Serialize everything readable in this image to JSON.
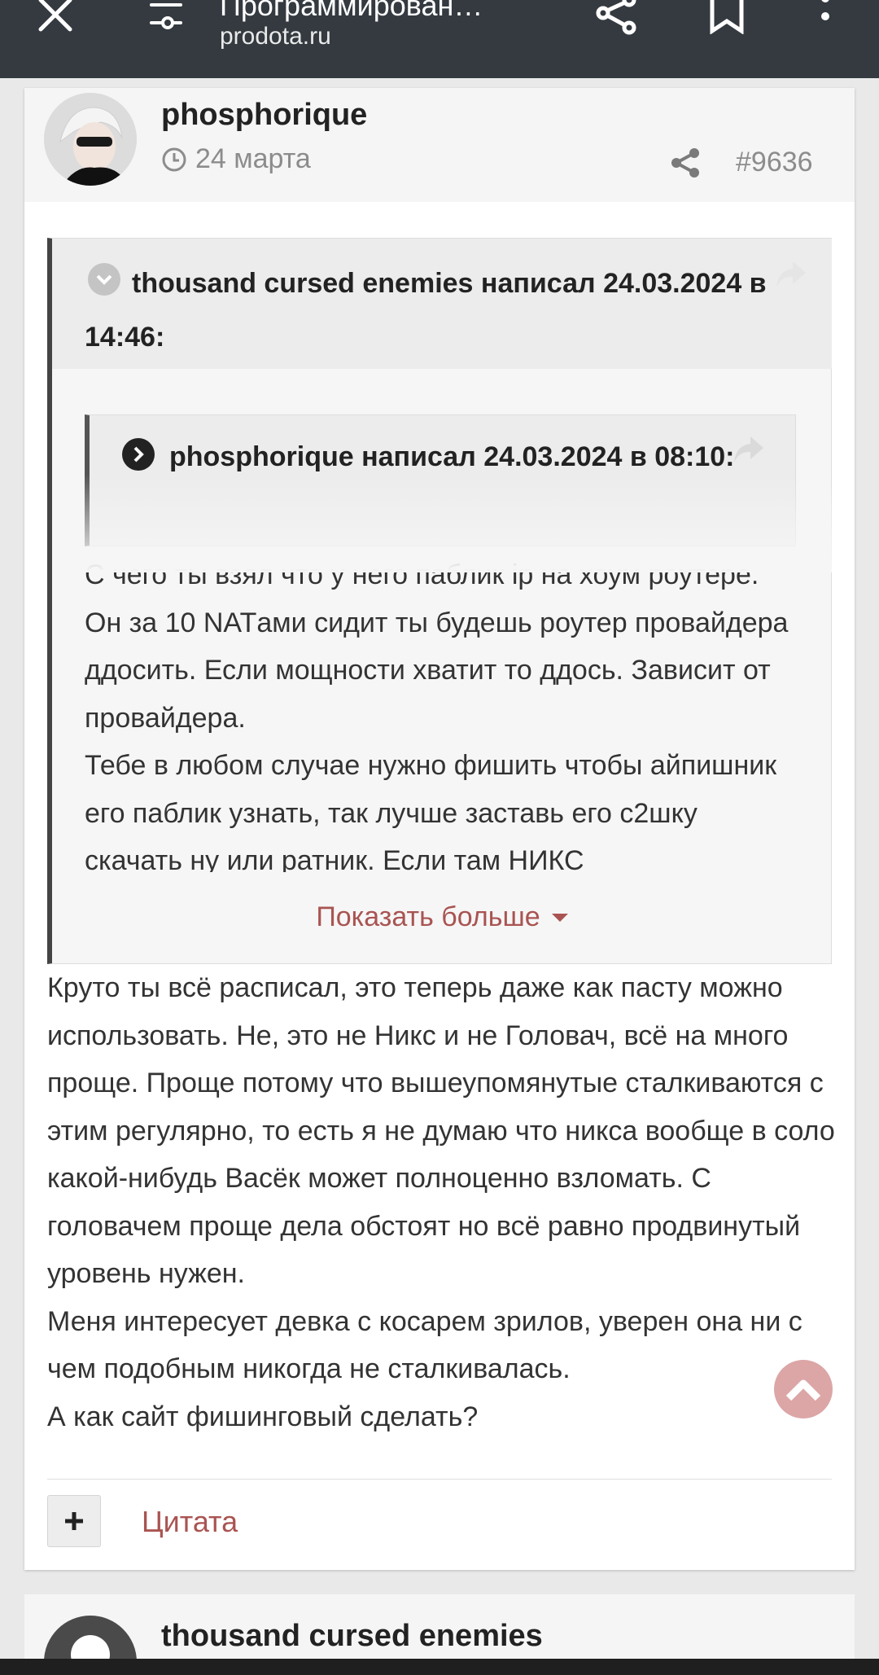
{
  "browser": {
    "title": "Программирован…",
    "domain": "prodota.ru",
    "icons": [
      "close-icon",
      "tune-icon",
      "share-icon",
      "bookmark-icon",
      "more-vert-icon"
    ]
  },
  "post": {
    "author": "phosphorique",
    "date": "24 марта",
    "number": "#9636",
    "outer_quote": {
      "header": "thousand cursed enemies написал 24.03.2024 в 14:46:"
    },
    "inner_quote": {
      "header": "phosphorique написал 24.03.2024 в 08:10:"
    },
    "quoted_lines": [
      "С чего ты взял что у него паблик ip на хоум роутере. Он за 10 NATами сидит ты будешь роутер провайдера ддосить. Если мощности хватит то ддось. Зависит от провайдера.",
      "Тебе в любом случае нужно фишить чтобы айпишник его паблик узнать, так лучше заставь его с2шку скачать ну или ратник. Если там НИКС"
    ],
    "show_more": "Показать больше",
    "body": [
      "Круто ты всё расписал, это теперь даже как пасту можно использовать. Не, это не Никс и не Головач, всё на много проще. Проще потому что вышеупомянутые сталкиваются с этим регулярно, то есть я не думаю что никса вообще в соло какой-нибудь Васёк может полноценно взломать. С головачем проще дела обстоят но всё равно продвинутый уровень нужен.",
      "Меня интересует девка с косарем зрилов, уверен она ни с чем подобным никогда не сталкивалась.",
      "А как сайт фишинговый сделать?"
    ],
    "actions": {
      "plus": "+",
      "quote": "Цитата"
    }
  },
  "next_post": {
    "author": "thousand cursed enemies"
  },
  "colors": {
    "toolbar": "#343a40",
    "accent": "#a95452",
    "meta": "#8c8c8c"
  }
}
